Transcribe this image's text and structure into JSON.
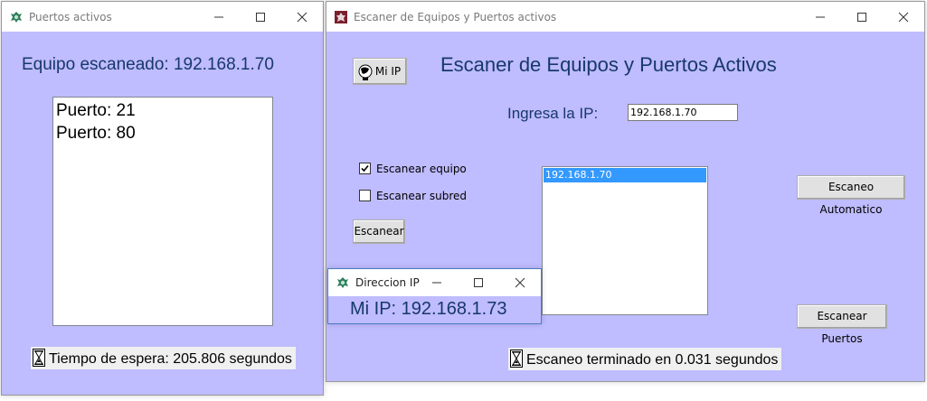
{
  "ports_window": {
    "title": "Puertos activos",
    "scanned_label": "Equipo escaneado: 192.168.1.70",
    "ports": [
      "Puerto: 21",
      "Puerto: 80"
    ],
    "wait_status": "Tiempo de espera: 205.806 segundos"
  },
  "scanner_window": {
    "title": "Escaner de Equipos y Puertos activos",
    "heading": "Escaner de Equipos y Puertos Activos",
    "my_ip_button": "Mi IP",
    "ip_label": "Ingresa la IP:",
    "ip_value": "192.168.1.70",
    "check_equipo": "Escanear equipo",
    "check_equipo_checked": true,
    "check_subred": "Escanear subred",
    "check_subred_checked": false,
    "scan_button": "Escanear",
    "results": [
      "192.168.1.70"
    ],
    "auto_scan_button": "Escaneo Automatico",
    "scan_ports_button": "Escanear Puertos",
    "finish_status": "Escaneo terminado en 0.031 segundos"
  },
  "ip_window": {
    "title": "Direccion IP",
    "my_ip": "Mi IP: 192.168.1.73"
  },
  "icons": {
    "app": "app-logo-icon",
    "hourglass": "hourglass-icon",
    "minimize": "minimize-icon",
    "maximize": "maximize-icon",
    "close": "close-icon"
  },
  "colors": {
    "window_bg": "#bfbcff",
    "label_text": "#17386a",
    "selection": "#3399ff"
  }
}
